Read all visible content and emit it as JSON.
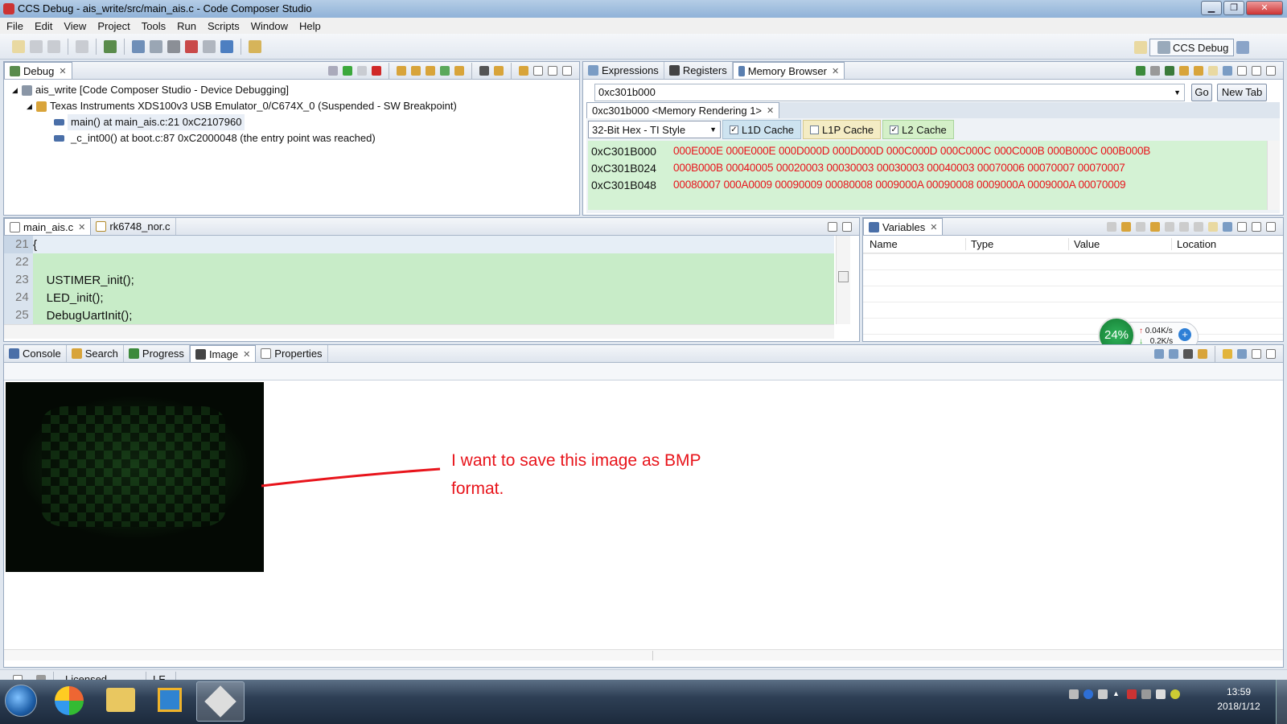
{
  "window": {
    "title": "CCS Debug - ais_write/src/main_ais.c - Code Composer Studio"
  },
  "menu": [
    "File",
    "Edit",
    "View",
    "Project",
    "Tools",
    "Run",
    "Scripts",
    "Window",
    "Help"
  ],
  "perspective": {
    "label": "CCS Debug"
  },
  "debug_view": {
    "tab": "Debug",
    "tree": [
      {
        "label": "ais_write [Code Composer Studio - Device Debugging]"
      },
      {
        "label": "Texas Instruments XDS100v3 USB Emulator_0/C674X_0 (Suspended - SW Breakpoint)"
      },
      {
        "label": "main() at main_ais.c:21 0xC2107960"
      },
      {
        "label": "_c_int00() at boot.c:87 0xC2000048  (the entry point was reached)"
      }
    ]
  },
  "memory_view": {
    "tabs": [
      "Expressions",
      "Registers",
      "Memory Browser"
    ],
    "address_value": "0xc301b000",
    "go_label": "Go",
    "new_tab_label": "New Tab",
    "rendering_tab": "0xc301b000 <Memory Rendering 1>",
    "format": "32-Bit Hex - TI Style",
    "caches": [
      {
        "label": "L1D Cache",
        "checked": "✓"
      },
      {
        "label": "L1P Cache",
        "checked": ""
      },
      {
        "label": "L2 Cache",
        "checked": "✓"
      }
    ],
    "rows": [
      {
        "addr": "0xC301B000",
        "data": "000E000E 000E000E 000D000D 000D000D 000C000D 000C000C 000C000B 000B000C 000B000B"
      },
      {
        "addr": "0xC301B024",
        "data": "000B000B 00040005 00020003 00030003 00030003 00040003 00070006 00070007 00070007"
      },
      {
        "addr": "0xC301B048",
        "data": "00080007 000A0009 00090009 00080008 0009000A 00090008 0009000A 0009000A 00070009"
      }
    ]
  },
  "editor": {
    "tabs": [
      "main_ais.c",
      "rk6748_nor.c"
    ],
    "lines": [
      {
        "num": "21",
        "text": "{"
      },
      {
        "num": "22",
        "text": ""
      },
      {
        "num": "23",
        "text": "    USTIMER_init();"
      },
      {
        "num": "24",
        "text": "    LED_init();"
      },
      {
        "num": "25",
        "text": "    DebugUartInit();"
      }
    ]
  },
  "variables_view": {
    "tab": "Variables",
    "columns": [
      "Name",
      "Type",
      "Value",
      "Location"
    ]
  },
  "net_widget": {
    "percent": "24%",
    "up": "0.04K/s",
    "down": "0.2K/s"
  },
  "bottom_tabs": [
    "Console",
    "Search",
    "Progress",
    "Image",
    "Properties"
  ],
  "annotation": {
    "line1": "I want to save this image as BMP",
    "line2": "format."
  },
  "status_bar": {
    "license": "Licensed",
    "endian": "LE"
  },
  "taskbar": {
    "time": "13:59",
    "date": "2018/1/12"
  },
  "colors": {
    "mem_data": "#e8141b",
    "mem_bg": "#d4f2d4",
    "code_bg": "#c8ecc8",
    "annotation": "#e8141b"
  }
}
